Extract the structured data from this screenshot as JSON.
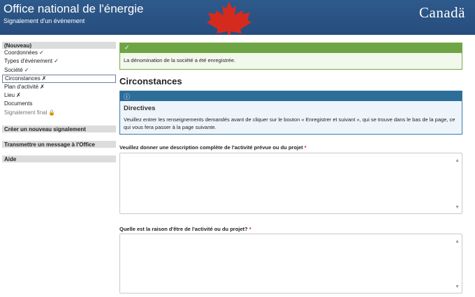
{
  "header": {
    "title": "Office national de l'énergie",
    "subtitle": "Signalement d'un événement",
    "wordmark": "Canadä"
  },
  "sidebar": {
    "section_new": "(Nouveau)",
    "items": [
      {
        "label": "Coordonnées",
        "mark": "✓"
      },
      {
        "label": "Types d'événement",
        "mark": "✓"
      },
      {
        "label": "Société",
        "mark": "✓"
      },
      {
        "label": "Circonstances",
        "mark": "✗"
      },
      {
        "label": "Plan d'activité",
        "mark": "✗"
      },
      {
        "label": "Lieu",
        "mark": "✗"
      },
      {
        "label": "Documents",
        "mark": ""
      },
      {
        "label": "Signalement final",
        "mark": "🔒"
      }
    ],
    "create_new": "Créer un nouveau signalement",
    "send_message": "Transmettre un message à l'Office",
    "help": "Aide"
  },
  "success_alert": {
    "icon": "✓",
    "message": "La dénomination de la société a été enregistrée."
  },
  "page_title": "Circonstances",
  "info_alert": {
    "icon": "ⓘ",
    "title": "Directives",
    "text": "Veuillez entrer les renseignements demandés avant de cliquer sur le bouton « Enregistrer et suivant », qui se trouve dans le bas de la page, ce qui vous fera passer à la page suivante."
  },
  "questions": [
    {
      "label": "Veuillez donner une description complète de l'activité prévue ou du projet",
      "required": "*",
      "value": ""
    },
    {
      "label": "Quelle est la raison d'être de l'activité ou du projet?",
      "required": "*",
      "value": ""
    }
  ],
  "colors": {
    "header": "#2f5a8c",
    "success": "#6ea544",
    "info": "#2d6e99",
    "required": "#cc2222"
  }
}
